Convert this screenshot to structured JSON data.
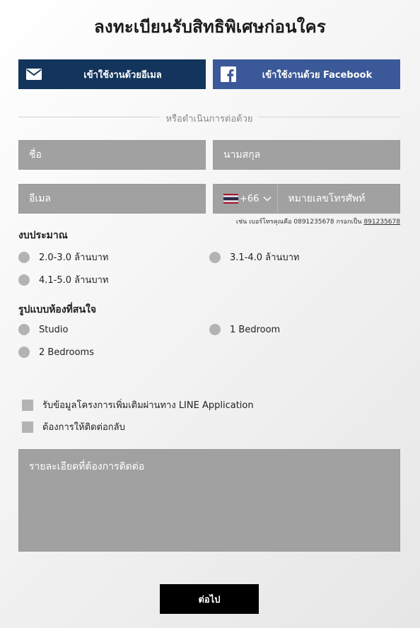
{
  "title": "ลงทะเบียนรับสิทธิพิเศษก่อนใคร",
  "social": {
    "email_label": "เข้าใช้งานด้วยอีเมล",
    "facebook_label": "เข้าใช้งานด้วย Facebook",
    "email_icon": "envelope-icon",
    "facebook_icon": "facebook-icon"
  },
  "divider_text": "หรือดำเนินการต่อด้วย",
  "fields": {
    "first_name_placeholder": "ชื่อ",
    "last_name_placeholder": "นามสกุล",
    "email_placeholder": "อีเมล",
    "country_code": "+66",
    "phone_placeholder": "หมายเลขโทรศัพท์"
  },
  "phone_hint": {
    "text": "เช่น เบอร์โทรคุณคือ 0891235678 กรอกเป็น",
    "example": "891235678"
  },
  "budget": {
    "label": "งบประมาณ",
    "options": [
      "2.0-3.0 ล้านบาท",
      "3.1-4.0 ล้านบาท",
      "4.1-5.0 ล้านบาท"
    ]
  },
  "room_type": {
    "label": "รูปแบบห้องที่สนใจ",
    "options": [
      "Studio",
      "1 Bedroom",
      "2 Bedrooms"
    ]
  },
  "checkboxes": [
    "รับข้อมูลโครงการเพิ่มเติมผ่านทาง LINE Application",
    "ต้องการให้ติดต่อกลับ"
  ],
  "details_placeholder": "รายละเอียดที่ต้องการติดต่อ",
  "submit_label": "ต่อไป",
  "colors": {
    "email_button": "#13355c",
    "facebook_button": "#3b5998",
    "field_bg": "#a1a1a1",
    "submit_bg": "#000000"
  }
}
